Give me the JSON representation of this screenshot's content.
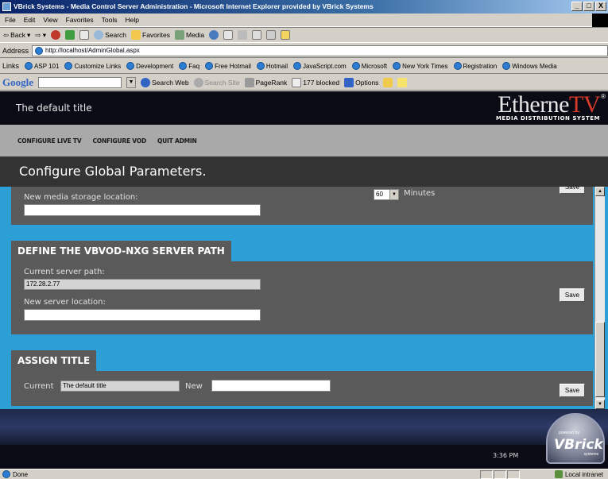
{
  "window": {
    "title": "VBrick Systems - Media Control Server Administration - Microsoft Internet Explorer provided by VBrick Systems",
    "min": "_",
    "max": "□",
    "close": "X"
  },
  "menu": [
    "File",
    "Edit",
    "View",
    "Favorites",
    "Tools",
    "Help"
  ],
  "toolbar": {
    "back": "Back",
    "search": "Search",
    "favorites": "Favorites",
    "media": "Media"
  },
  "address": {
    "label": "Address",
    "url": "http://localhost/AdminGlobal.aspx"
  },
  "links": {
    "label": "Links",
    "items": [
      "ASP 101",
      "Customize Links",
      "Development",
      "Faq",
      "Free Hotmail",
      "Hotmail",
      "JavaScript.com",
      "Microsoft",
      "New York Times",
      "Registration",
      "Windows Media"
    ]
  },
  "google": {
    "logo": "Google",
    "search_web": "Search Web",
    "search_site": "Search Site",
    "pagerank": "PageRank",
    "blocked": "177 blocked",
    "options": "Options"
  },
  "page": {
    "site_title": "The default title",
    "brand_main_a": "Etherne",
    "brand_main_b": "TV",
    "brand_reg": "®",
    "brand_sub": "MEDIA DISTRIBUTION SYSTEM",
    "nav": [
      "CONFIGURE LIVE TV",
      "CONFIGURE VOD",
      "QUIT ADMIN"
    ],
    "section_title": "Configure Global Parameters.",
    "storage": {
      "label": "New media storage location:",
      "value": "",
      "interval": "60",
      "interval_unit": "Minutes",
      "save": "Save"
    },
    "server_path": {
      "heading": "DEFINE THE VBVOD-NXG SERVER PATH",
      "current_label": "Current server path:",
      "current_value": "172.28.2.77",
      "new_label": "New server location:",
      "new_value": "",
      "save": "Save"
    },
    "title_section": {
      "heading": "ASSIGN TITLE",
      "current_label": "Current",
      "current_value": "The default title",
      "new_label": "New",
      "new_value": "",
      "save": "Save"
    },
    "clock": "3:36 PM",
    "vbrick_powered": "powered by",
    "vbrick_name": "VBrick",
    "vbrick_sys": "systems"
  },
  "status": {
    "text": "Done",
    "zone": "Local intranet"
  }
}
